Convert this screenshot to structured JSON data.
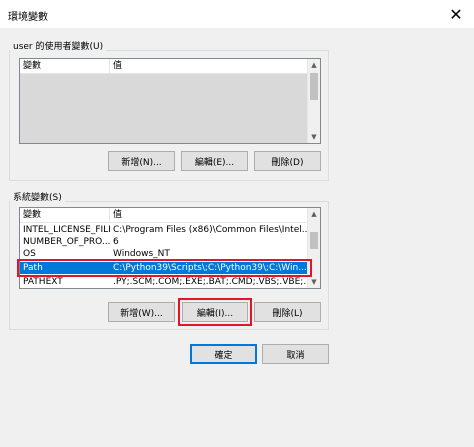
{
  "window": {
    "title": "環境變數",
    "close_glyph": "✕"
  },
  "user_vars": {
    "group_label": "user 的使用者變數(U)",
    "columns": [
      "變數",
      "值"
    ],
    "rows": [],
    "buttons": {
      "new": "新增(N)...",
      "edit": "編輯(E)...",
      "delete": "刪除(D)"
    }
  },
  "system_vars": {
    "group_label": "系統變數(S)",
    "columns": [
      "變數",
      "值"
    ],
    "rows": [
      {
        "name": "INTEL_LICENSE_FILE",
        "value": "C:\\Program Files (x86)\\Common Files\\Intel..."
      },
      {
        "name": "NUMBER_OF_PRO...",
        "value": "6"
      },
      {
        "name": "OS",
        "value": "Windows_NT"
      },
      {
        "name": "Path",
        "value": "C:\\Python39\\Scripts\\;C:\\Python39\\;C:\\Win..."
      },
      {
        "name": "PATHEXT",
        "value": ".PY;.SCM;.COM;.EXE;.BAT;.CMD;.VBS;.VBE;..."
      }
    ],
    "selected_row": "Path",
    "buttons": {
      "new": "新增(W)...",
      "edit": "編輯(I)...",
      "delete": "刪除(L)"
    }
  },
  "footer": {
    "ok": "確定",
    "cancel": "取消"
  },
  "icons": {
    "scroll_up": "▲",
    "scroll_down": "▼"
  },
  "colors": {
    "selection": "#0078d7",
    "highlight_box": "#e0152a",
    "default_button_border": "#0078d7"
  }
}
